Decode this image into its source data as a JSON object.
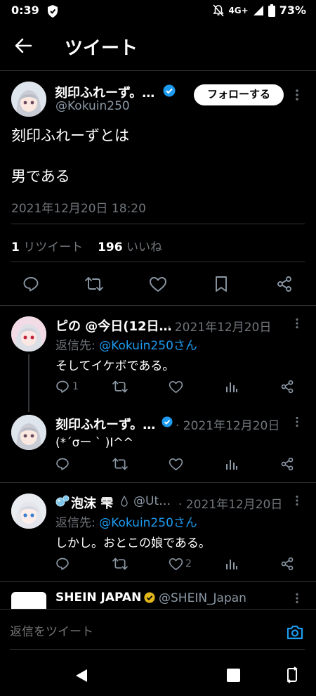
{
  "status": {
    "time": "0:39",
    "network": "4G+",
    "battery": "73%"
  },
  "header": {
    "title": "ツイート"
  },
  "main_tweet": {
    "author_name": "刻印ふれーず。…",
    "handle": "@Kokuin250",
    "follow_label": "フォローする",
    "text_line1": "刻印ふれーずとは",
    "text_line2": "男である",
    "timestamp": "2021年12月20日 18:20",
    "retweet_count": "1",
    "retweet_label": "リツイート",
    "like_count": "196",
    "like_label": "いいね"
  },
  "replies": [
    {
      "author_name": "ピの @今日(12日…",
      "date": "· 2021年12月20日",
      "reply_to_prefix": "返信先: ",
      "reply_to_user": "@Kokuin250さん",
      "text": "そしてイケボである。",
      "reply_count": "1",
      "like_count": ""
    },
    {
      "author_name": "刻印ふれーず。…",
      "date": "· 2021年12月20日",
      "text": "(*ˊσー ˋ )I^^",
      "reply_count": "",
      "like_count": ""
    },
    {
      "author_name": "泡沫 雫",
      "handle": "@Ut…",
      "date": "· 2021年12月20日",
      "reply_to_prefix": "返信先: ",
      "reply_to_user": "@Kokuin250さん",
      "text": "しかし。おとこの娘である。",
      "reply_count": "",
      "like_count": "2"
    },
    {
      "author_name": "SHEIN JAPAN",
      "handle": "@SHEIN_Japan"
    }
  ],
  "reply_input": {
    "placeholder": "返信をツイート"
  },
  "colors": {
    "accent": "#1d9bf0",
    "verified_gold": "#e2b719",
    "background": "#000000"
  }
}
